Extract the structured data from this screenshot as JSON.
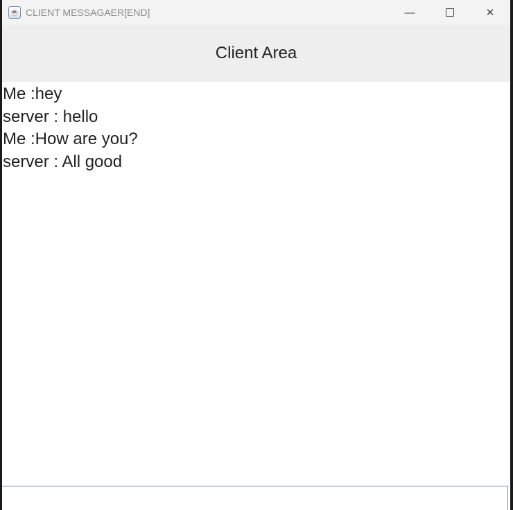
{
  "window": {
    "title": "CLIENT MESSAGAER[END]"
  },
  "header": {
    "title": "Client Area"
  },
  "messages": [
    "Me :hey",
    "server : hello",
    "Me :How are you?",
    "server : All good"
  ],
  "input": {
    "value": ""
  }
}
